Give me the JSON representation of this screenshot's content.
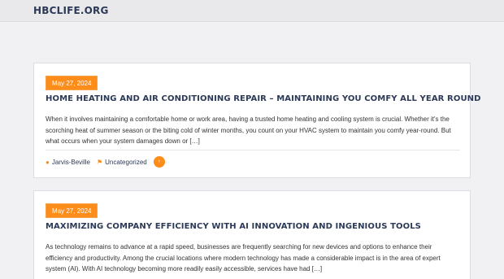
{
  "site": {
    "title": "HBCLIFE.ORG"
  },
  "posts": [
    {
      "date": "May 27, 2024",
      "title": "HOME HEATING AND AIR CONDITIONING REPAIR – MAINTAINING YOU COMFY ALL YEAR ROUND",
      "excerpt": "When it involves maintaining a comfortable home or work area, having a trusted home heating and cooling system is crucial. Whether it's the scorching heat of summer season or the biting cold of winter months, you count on your HVAC system to maintain you comfy year-round. But what occurs when your system damages down or […]",
      "author": "Jarvis-Beville",
      "category": "Uncategorized",
      "more_label": "›"
    },
    {
      "date": "May 27, 2024",
      "title": "MAXIMIZING COMPANY EFFICIENCY WITH AI INNOVATION AND INGENIOUS TOOLS",
      "excerpt": "As technology remains to advance at a rapid speed, businesses are frequently searching for new devices and options to enhance their efficiency and productivity. Among the crucial locations where modern technology has made a considerable impact is in the area of expert system (AI). With AI technology becoming more readily easily accessible, services have had […]"
    }
  ],
  "icons": {
    "author": "user-icon",
    "category": "bookmark-icon"
  },
  "colors": {
    "accent": "#fd8d1b",
    "title": "#2c3a57"
  }
}
